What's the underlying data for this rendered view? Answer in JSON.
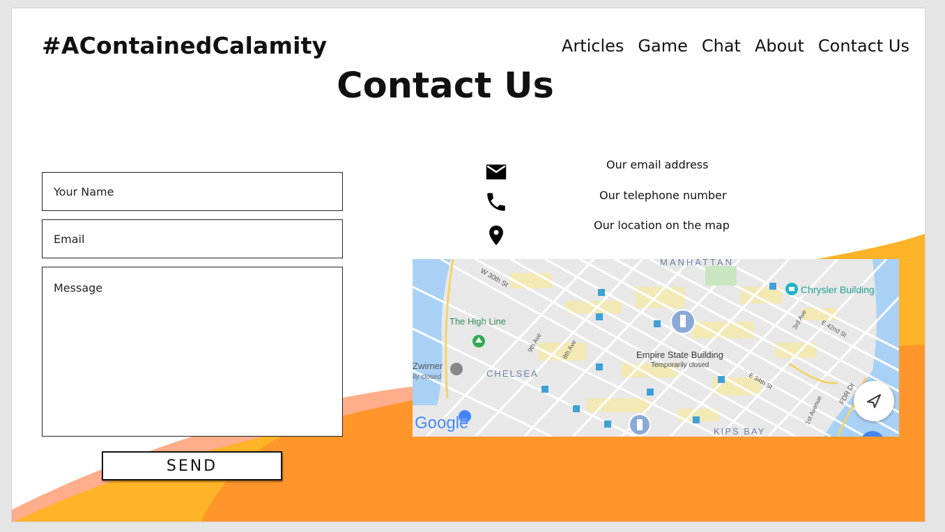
{
  "site": {
    "brand": "#AContainedCalamity"
  },
  "nav": {
    "items": [
      {
        "label": "Articles"
      },
      {
        "label": "Game"
      },
      {
        "label": "Chat"
      },
      {
        "label": "About"
      },
      {
        "label": "Contact Us"
      }
    ]
  },
  "page": {
    "title": "Contact Us"
  },
  "form": {
    "name_placeholder": "Your Name",
    "email_placeholder": "Email",
    "message_placeholder": "Message",
    "name_value": "",
    "email_value": "",
    "message_value": "",
    "send_label": "SEND"
  },
  "contact": {
    "email_text": "Our email address",
    "phone_text": "Our telephone number",
    "location_text": "Our location on the map",
    "icons": [
      "mail-icon",
      "phone-icon",
      "location-pin-icon"
    ]
  },
  "map": {
    "provider_logo": "Google",
    "labels": {
      "manhattan": "MANHATTAN",
      "w30": "W 30th St",
      "high_line": "The High Line",
      "ninth_ave": "9th Ave",
      "eighth_ave": "8th Ave",
      "zwirner": "Zwirner",
      "zwirner_status": "ily closed",
      "chelsea": "CHELSEA",
      "esb": "Empire State Building",
      "esb_status": "Temporarily closed",
      "chrysler": "Chrysler Building",
      "third_ave": "3rd Ave",
      "e42": "E 42nd St",
      "e34": "E 34th St",
      "first_ave": "1st Avenue",
      "fdr": "FDR Dr",
      "kips_bay": "KIPS BAY"
    },
    "icons": [
      "transit-icon",
      "park-pin-icon",
      "gallery-pin-icon",
      "landmark-pin-icon",
      "camera-pin-icon",
      "navigation-arrow-icon"
    ]
  },
  "colors": {
    "wave_light": "#ffb327",
    "wave_orange": "#ff962b",
    "wave_salmon": "#ffad8a",
    "water": "#a9d1f5",
    "map_land": "#e8e8e8",
    "map_area": "#f5eab0",
    "map_label": "#1f9e93"
  }
}
